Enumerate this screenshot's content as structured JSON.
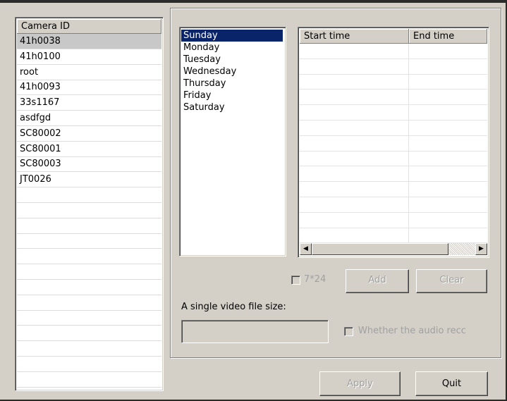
{
  "camera_list": {
    "header": "Camera ID",
    "items": [
      "41h0038",
      "41h0100",
      "root",
      "41h0093",
      "33s1167",
      "asdfgd",
      "SC80002",
      "SC80001",
      "SC80003",
      "JT0026"
    ],
    "selected_index": 0
  },
  "days": {
    "items": [
      "Sunday",
      "Monday",
      "Tuesday",
      "Wednesday",
      "Thursday",
      "Friday",
      "Saturday"
    ],
    "selected_index": 0
  },
  "schedule_table": {
    "columns": [
      "Start time",
      "End time"
    ],
    "rows": []
  },
  "controls": {
    "all_day_checkbox_label": "7*24",
    "add_button": "Add",
    "clear_button": "Clear",
    "file_size_label": "A single video file size:",
    "file_size_value": "",
    "audio_checkbox_label": "Whether the audio recc",
    "apply_button": "Apply",
    "quit_button": "Quit"
  },
  "colors": {
    "selection_blue": "#0a246a",
    "face": "#d4d0c8"
  }
}
